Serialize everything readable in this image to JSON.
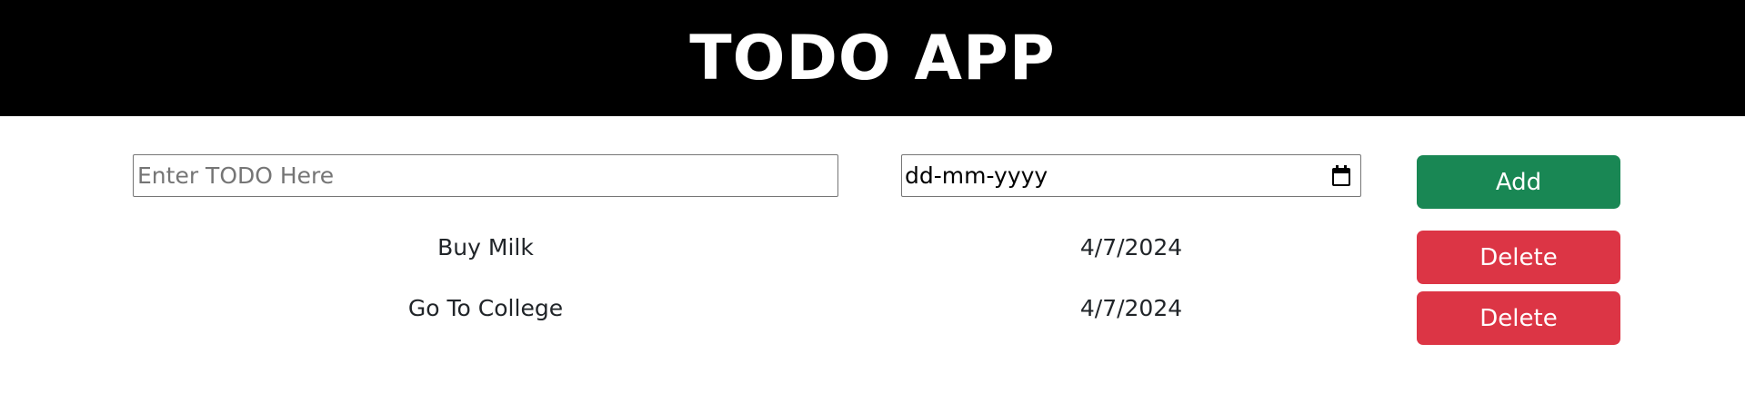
{
  "header": {
    "title": "TODO APP"
  },
  "form": {
    "todo_placeholder": "Enter TODO Here",
    "date_placeholder": "dd-mm-yyyy",
    "add_label": "Add"
  },
  "todos": [
    {
      "name": "Buy Milk",
      "date": "4/7/2024",
      "delete_label": "Delete"
    },
    {
      "name": "Go To College",
      "date": "4/7/2024",
      "delete_label": "Delete"
    }
  ],
  "colors": {
    "header_bg": "#000000",
    "add_button": "#198754",
    "delete_button": "#dc3545"
  },
  "icons": {
    "date_picker": "calendar-icon"
  }
}
